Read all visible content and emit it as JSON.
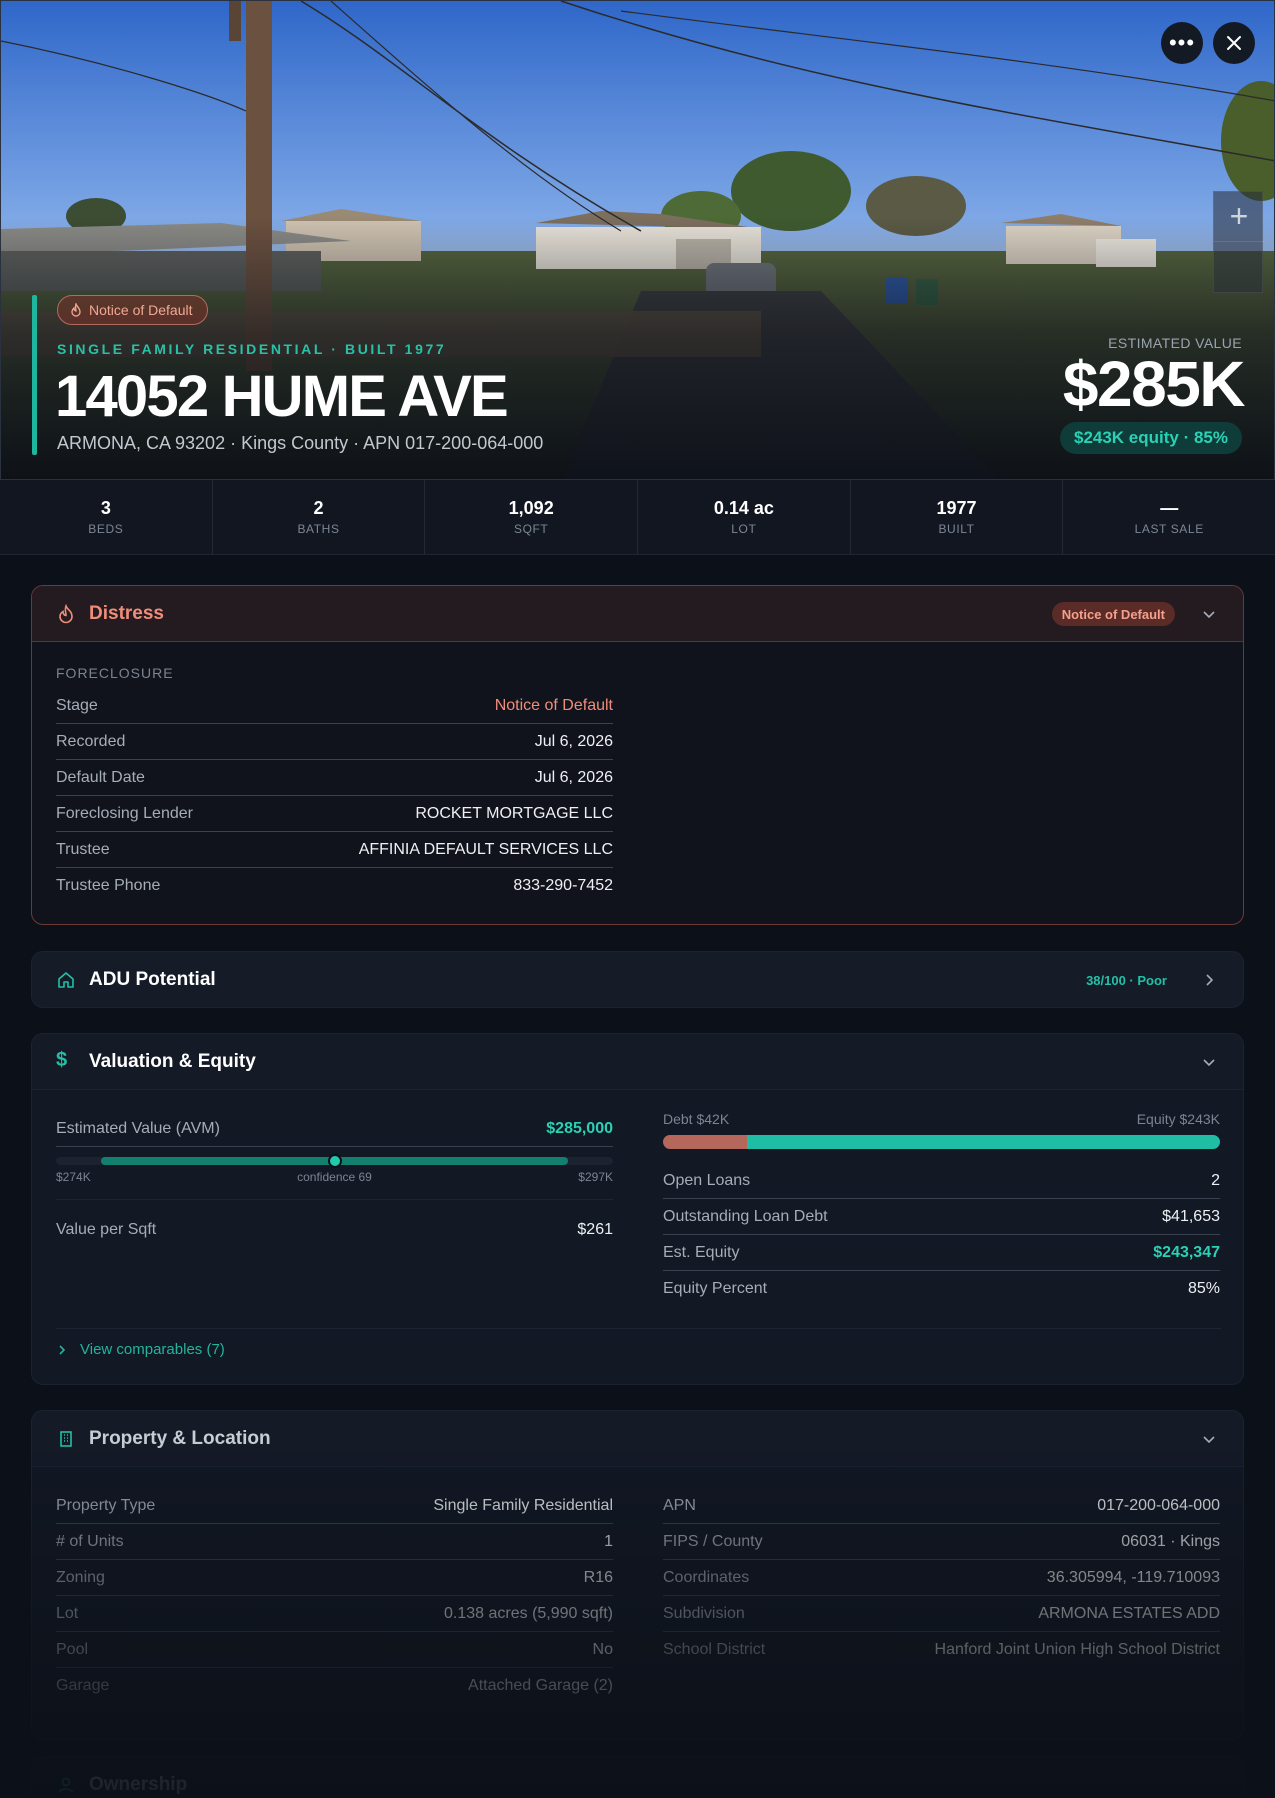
{
  "hero": {
    "badge": "Notice of Default",
    "kicker": "SINGLE FAMILY RESIDENTIAL · BUILT 1977",
    "address": "14052 HUME AVE",
    "subline": "ARMONA, CA 93202 · Kings County · APN 017-200-064-000",
    "estimated_label": "ESTIMATED VALUE",
    "estimated_value": "$285K",
    "equity_pill": "$243K equity · 85%"
  },
  "stats": [
    {
      "value": "3",
      "label": "BEDS"
    },
    {
      "value": "2",
      "label": "BATHS"
    },
    {
      "value": "1,092",
      "label": "SQFT"
    },
    {
      "value": "0.14 ac",
      "label": "LOT"
    },
    {
      "value": "1977",
      "label": "BUILT"
    },
    {
      "value": "—",
      "label": "LAST SALE"
    }
  ],
  "distress": {
    "title": "Distress",
    "tag": "Notice of Default",
    "section": "FORECLOSURE",
    "rows": [
      {
        "k": "Stage",
        "v": "Notice of Default"
      },
      {
        "k": "Recorded",
        "v": "Jul 6, 2026"
      },
      {
        "k": "Default Date",
        "v": "Jul 6, 2026"
      },
      {
        "k": "Foreclosing Lender",
        "v": "ROCKET MORTGAGE LLC"
      },
      {
        "k": "Trustee",
        "v": "AFFINIA DEFAULT SERVICES LLC"
      },
      {
        "k": "Trustee Phone",
        "v": "833-290-7452"
      }
    ]
  },
  "adu": {
    "title": "ADU Potential",
    "score": "38/100 · Poor"
  },
  "valuation": {
    "title": "Valuation & Equity",
    "avm_label": "Estimated Value (AVM)",
    "avm_value": "$285,000",
    "range_low": "$274K",
    "range_high": "$297K",
    "confidence": "confidence 69",
    "confidence_position": 0.5,
    "range_start": 0.08,
    "range_end": 0.92,
    "ppsf_label": "Value per Sqft",
    "ppsf_value": "$261",
    "debt_label": "Debt $42K",
    "equity_label": "Equity $243K",
    "equity_percent_value": 85,
    "rows": [
      {
        "k": "Open Loans",
        "v": "2"
      },
      {
        "k": "Outstanding Loan Debt",
        "v": "$41,653"
      },
      {
        "k": "Est. Equity",
        "v": "$243,347"
      },
      {
        "k": "Equity Percent",
        "v": "85%"
      }
    ],
    "comps": "View comparables (7)"
  },
  "property": {
    "title": "Property & Location",
    "left": [
      {
        "k": "Property Type",
        "v": "Single Family Residential"
      },
      {
        "k": "# of Units",
        "v": "1"
      },
      {
        "k": "Zoning",
        "v": "R16"
      },
      {
        "k": "Lot",
        "v": "0.138 acres (5,990 sqft)"
      },
      {
        "k": "Pool",
        "v": "No"
      },
      {
        "k": "Garage",
        "v": "Attached Garage (2)"
      }
    ],
    "right": [
      {
        "k": "APN",
        "v": "017-200-064-000"
      },
      {
        "k": "FIPS / County",
        "v": "06031 · Kings"
      },
      {
        "k": "Coordinates",
        "v": "36.305994, -119.710093"
      },
      {
        "k": "Subdivision",
        "v": "ARMONA ESTATES ADD"
      },
      {
        "k": "School District",
        "v": "Hanford Joint Union High School District"
      }
    ]
  },
  "ownership": {
    "title": "Ownership"
  },
  "colors": {
    "accent": "#1fb6a0",
    "distress": "#f08d79",
    "debt": "#b5675c",
    "background": "#0c1018"
  }
}
